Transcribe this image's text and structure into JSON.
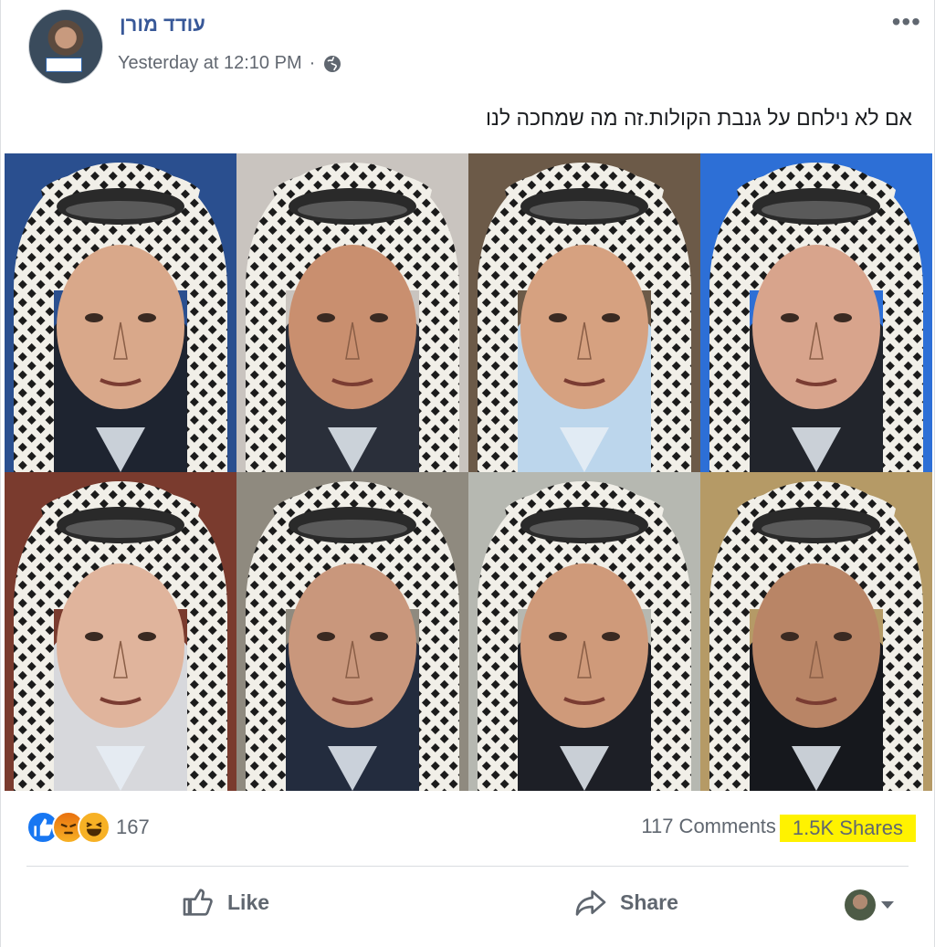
{
  "post": {
    "author": "עודד מורן",
    "timestamp": "Yesterday at 12:10 PM",
    "separator": "·",
    "audience_icon": "globe-icon",
    "more_label": "•••",
    "text": "אם לא נילחם על גנבת הקולות.זה מה שמחכה לנו"
  },
  "image": {
    "icon_names": [
      "portrait-1",
      "portrait-2",
      "portrait-3",
      "portrait-4",
      "portrait-5",
      "portrait-6",
      "portrait-7",
      "portrait-8"
    ]
  },
  "footer": {
    "reaction_icons": [
      "like-reaction-icon",
      "angry-reaction-icon",
      "haha-reaction-icon"
    ],
    "reaction_count": "167",
    "comments": "117 Comments",
    "shares": "1.5K Shares",
    "like_label": "Like",
    "share_label": "Share"
  },
  "colors": {
    "author": "#385898",
    "highlight": "#fff200",
    "like_blue": "#1877f2"
  }
}
